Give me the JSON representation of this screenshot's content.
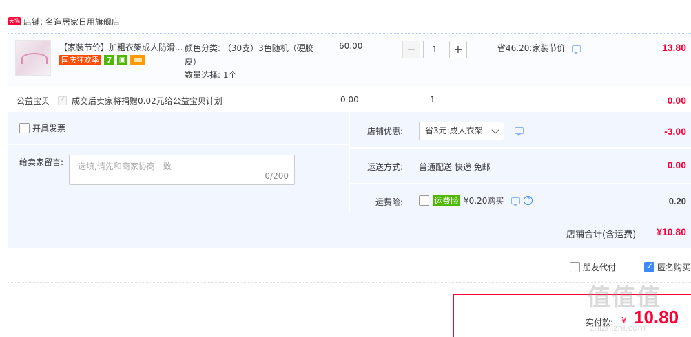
{
  "shop": {
    "badge": "天猫",
    "label": "店铺: 名造居家日用旗舰店"
  },
  "item": {
    "title": "【家装节价】加粗衣架成人防滑...",
    "badges": {
      "festival": "国庆狂欢季",
      "seven": "7",
      "box": "",
      "card": ""
    },
    "sku_color": "颜色分类: （30支）3色随机（硬胶皮）",
    "sku_qty": "数量选择: 1个",
    "price": "60.00",
    "quantity": "1",
    "minus": "−",
    "plus": "+",
    "save": "省46.20:家装节价",
    "subtotal": "13.80"
  },
  "charity": {
    "label": "公益宝贝",
    "text": "成交后卖家将捐赠0.02元给公益宝贝计划",
    "price": "0.00",
    "qty": "1",
    "subtotal": "0.00"
  },
  "invoice": {
    "label": "开具发票"
  },
  "message": {
    "label": "给卖家留言:",
    "placeholder": "选填,请先和商家协商一致",
    "count": "0/200"
  },
  "shop_discount": {
    "label": "店铺优惠:",
    "selected": "省3元:成人衣架",
    "amount": "-3.00"
  },
  "shipping": {
    "label": "运送方式:",
    "value": "普通配送 快递 免邮",
    "amount": "0.00"
  },
  "insurance": {
    "label": "运费险:",
    "tag": "运费险",
    "value": "¥0.20购买",
    "amount": "0.20"
  },
  "total": {
    "label": "店铺合计(含运费)",
    "amount": "¥10.80"
  },
  "bottom": {
    "friend_pay": "朋友代付",
    "anonymous": "匿名购买"
  },
  "pay": {
    "label": "实付款:",
    "currency": "¥",
    "amount": "10.80"
  },
  "watermark": {
    "text": "值值值",
    "url": "zhizhizhi.com"
  },
  "colors": {
    "accent_red": "#ff0036",
    "accent_blue": "#3d8aff",
    "panel_bg": "#f2f7ff",
    "green_tag": "#4cb800"
  }
}
